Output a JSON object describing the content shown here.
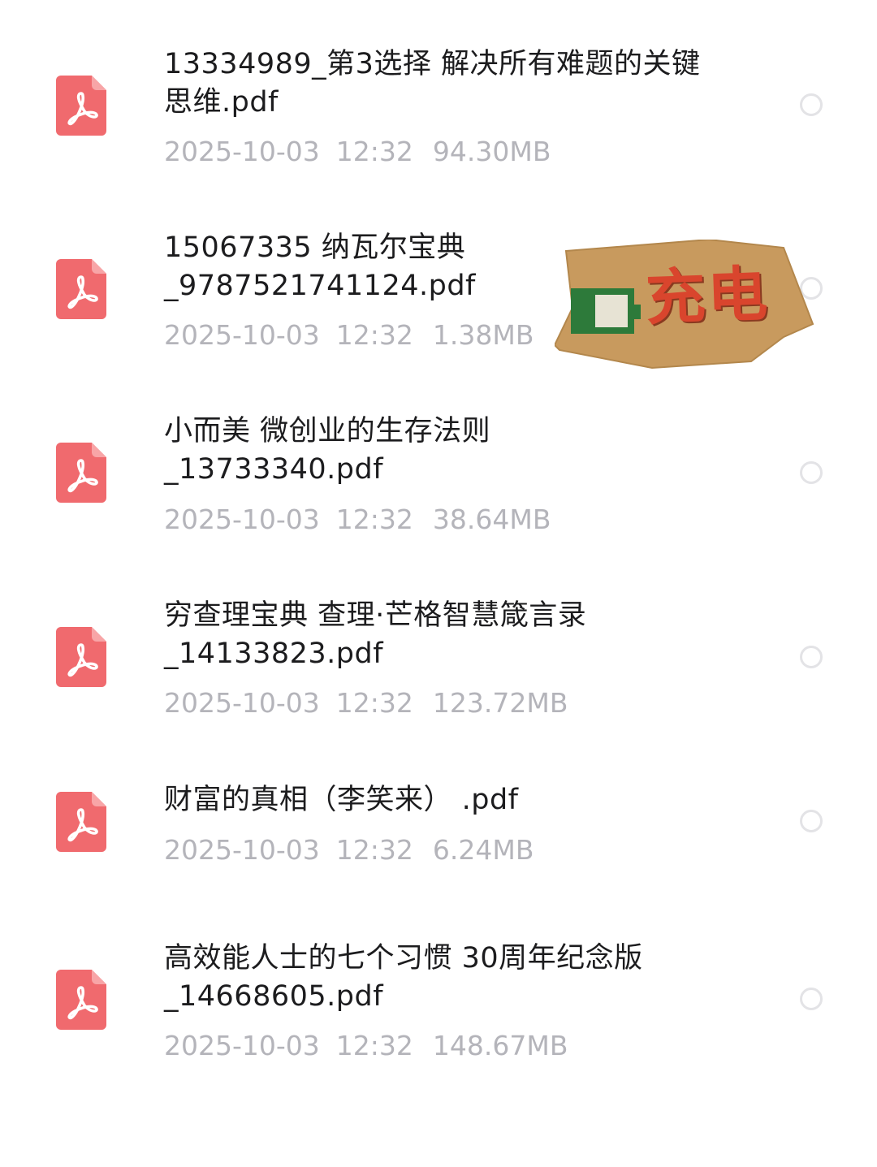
{
  "files": [
    {
      "name": "13334989_第3选择 解决所有难题的关键\n思维.pdf",
      "date": "2025-10-03",
      "time": "12:32",
      "size": "94.30MB",
      "icon": "pdf-icon",
      "selected": false
    },
    {
      "name": "15067335 纳瓦尔宝典\n_9787521741124.pdf",
      "date": "2025-10-03",
      "time": "12:32",
      "size": "1.38MB",
      "icon": "pdf-icon",
      "selected": false
    },
    {
      "name": "小而美  微创业的生存法则\n_13733340.pdf",
      "date": "2025-10-03",
      "time": "12:32",
      "size": "38.64MB",
      "icon": "pdf-icon",
      "selected": false
    },
    {
      "name": "穷查理宝典  查理·芒格智慧箴言录\n_14133823.pdf",
      "date": "2025-10-03",
      "time": "12:32",
      "size": "123.72MB",
      "icon": "pdf-icon",
      "selected": false
    },
    {
      "name": "财富的真相（李笑来） .pdf",
      "date": "2025-10-03",
      "time": "12:32",
      "size": "6.24MB",
      "icon": "pdf-icon",
      "selected": false
    },
    {
      "name": "高效能人士的七个习惯 30周年纪念版\n_14668605.pdf",
      "date": "2025-10-03",
      "time": "12:32",
      "size": "148.67MB",
      "icon": "pdf-icon",
      "selected": false
    }
  ],
  "sticker": {
    "text": "充电",
    "icon": "battery-icon",
    "background_color": "#c89a5e",
    "text_color": "#d9452d",
    "battery_color": "#2d7a3a"
  },
  "colors": {
    "pdf_icon": "#f06a6e",
    "meta_text": "#b4b4ba",
    "radio_border": "#e3e3e6"
  }
}
